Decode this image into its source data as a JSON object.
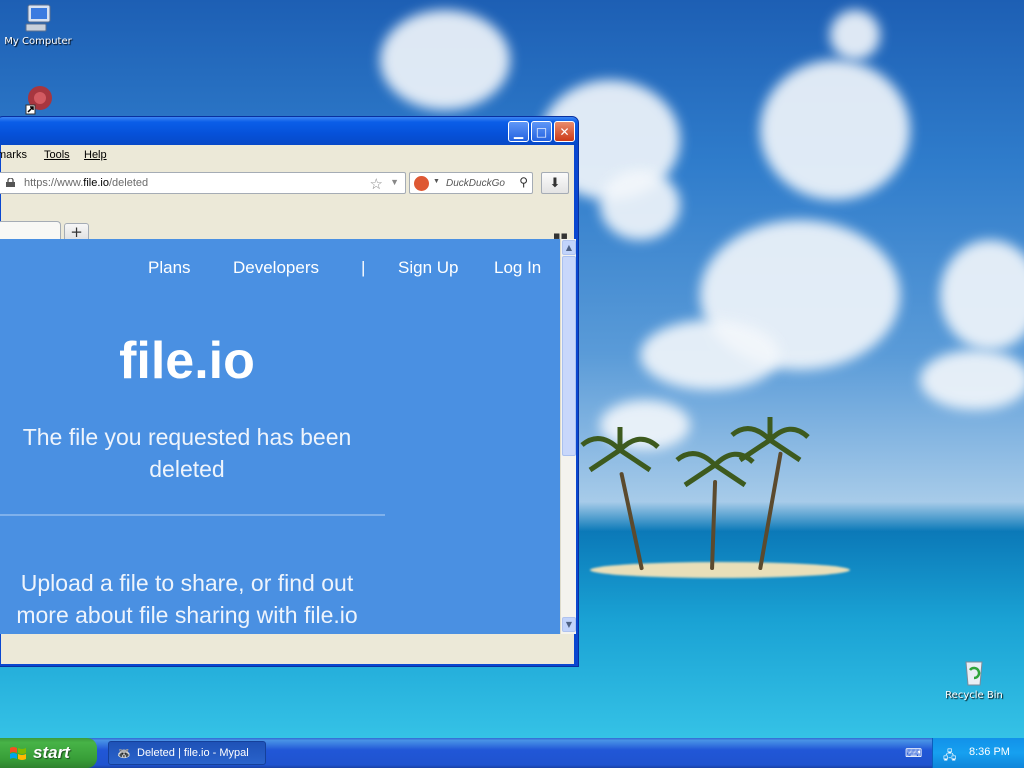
{
  "desktop": {
    "icons": [
      {
        "label": "My Computer",
        "icon": "my-computer-icon"
      },
      {
        "label": "",
        "icon": "shortcut-app-icon"
      },
      {
        "label": "Recycle Bin",
        "icon": "recycle-bin-icon"
      }
    ]
  },
  "window": {
    "title_buttons": {
      "minimize": "▁",
      "maximize": "□",
      "close": "✕"
    },
    "menu": [
      {
        "label": "marks"
      },
      {
        "label": "Tools"
      },
      {
        "label": "Help"
      }
    ],
    "url": {
      "prefix": "https://www.",
      "domain": "file.io",
      "path": "/deleted"
    },
    "search": {
      "placeholder": "DuckDuckGo",
      "engine_icon": "duckduckgo-icon"
    },
    "new_tab_label": "+",
    "tab_list_glyph": "▪▪"
  },
  "page": {
    "nav": {
      "plans": "Plans",
      "developers": "Developers",
      "separator": "|",
      "signup": "Sign Up",
      "login": "Log In"
    },
    "logo": "file.io",
    "message": "The file you requested has been deleted",
    "promo": "Upload a file to share, or find out more about file sharing with file.io",
    "background_color": "#4a90e2"
  },
  "taskbar": {
    "start_label": "start",
    "task_label": "Deleted | file.io - Mypal",
    "clock": "8:36 PM"
  }
}
